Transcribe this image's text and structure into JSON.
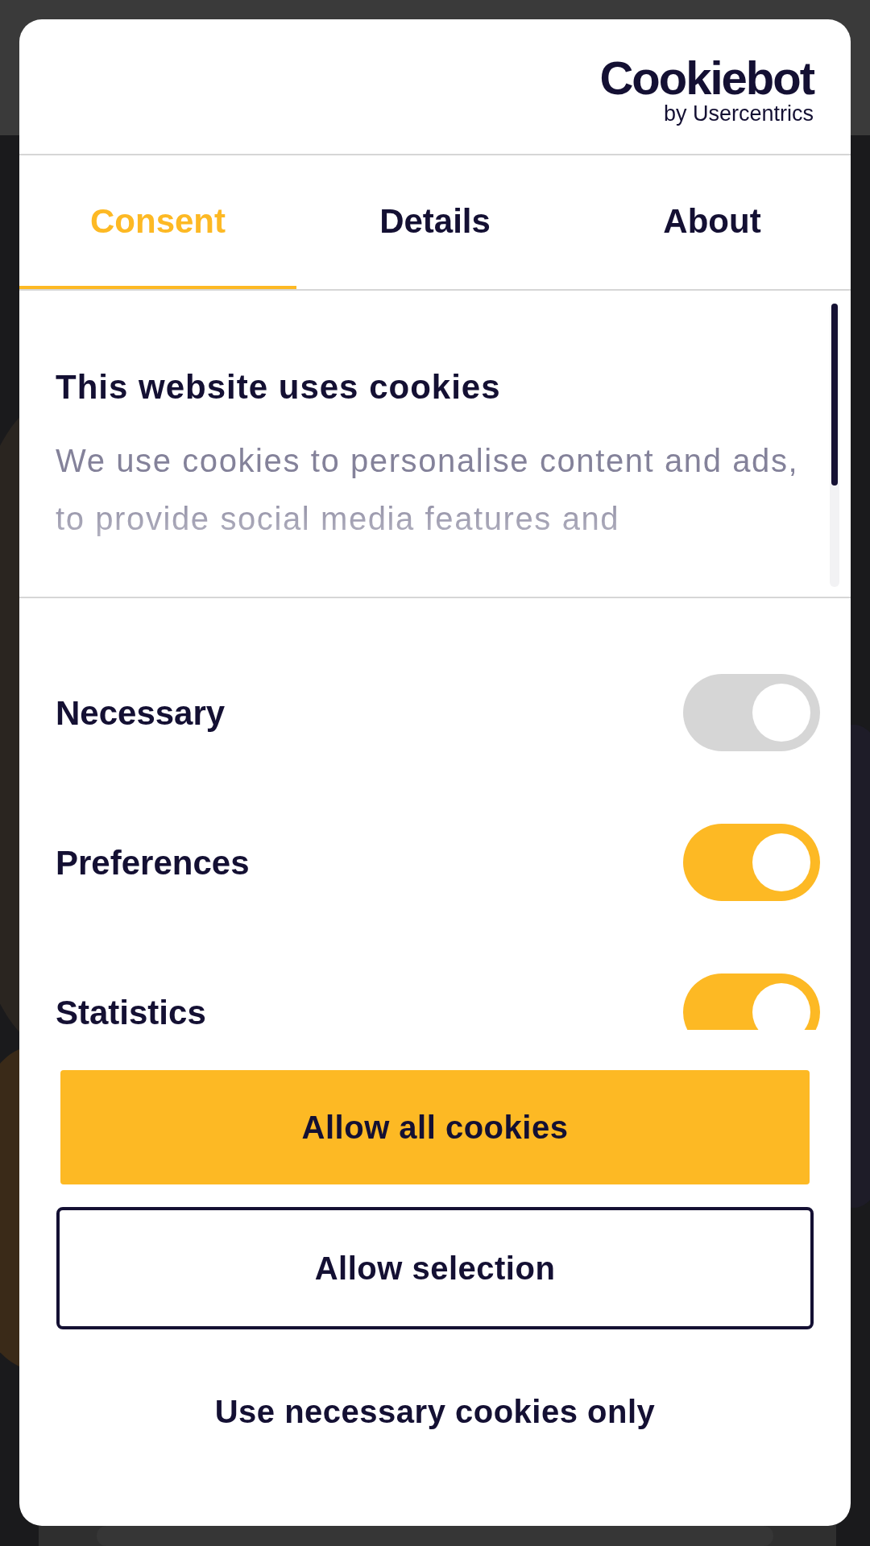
{
  "logo": {
    "name": "Cookiebot",
    "tagline": "by Usercentrics"
  },
  "tabs": [
    {
      "label": "Consent",
      "selected": true
    },
    {
      "label": "Details",
      "selected": false
    },
    {
      "label": "About",
      "selected": false
    }
  ],
  "consent": {
    "title": "This website uses cookies",
    "body": "We use cookies to personalise content and ads, to provide social media features and"
  },
  "categories": [
    {
      "name": "Necessary",
      "on": true,
      "disabled": true
    },
    {
      "name": "Preferences",
      "on": true,
      "disabled": false
    },
    {
      "name": "Statistics",
      "on": true,
      "disabled": false
    }
  ],
  "buttons": [
    {
      "label": "Allow all cookies",
      "kind": "primary"
    },
    {
      "label": "Allow selection",
      "kind": "outline"
    },
    {
      "label": "Use necessary cookies only",
      "kind": "text"
    }
  ]
}
